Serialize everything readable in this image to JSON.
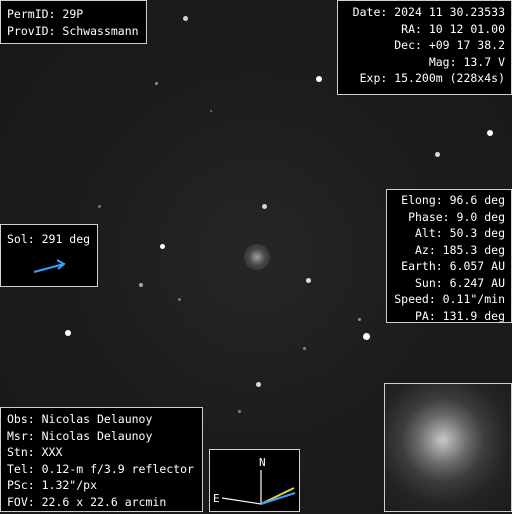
{
  "ident": {
    "perm_id_label": "PermID:",
    "perm_id": "29P",
    "prov_id_label": "ProvID:",
    "prov_id": "Schwassmann"
  },
  "observation_info": {
    "date": "Date: 2024 11 30.23533",
    "ra": "RA: 10 12 01.00",
    "dec": "Dec: +09 17 38.2",
    "mag": "Mag: 13.7 V",
    "exp": "Exp: 15.200m (228x4s)"
  },
  "geometry": {
    "elong": "Elong: 96.6 deg",
    "phase": "Phase: 9.0 deg",
    "alt": "Alt: 50.3 deg",
    "az": "Az: 185.3 deg",
    "earth": "Earth: 6.057 AU",
    "sun": "Sun: 6.247 AU",
    "speed": "Speed: 0.11\"/min",
    "pa": "PA: 131.9 deg"
  },
  "sol": {
    "label": "Sol: 291 deg",
    "arrow_color": "#3aa0ff"
  },
  "observer": {
    "obs": "Obs: Nicolas Delaunoy",
    "msr": "Msr: Nicolas Delaunoy",
    "stn": "Stn: XXX",
    "tel": "Tel: 0.12-m f/3.9 reflector",
    "psc": "PSc: 1.32\"/px",
    "fov": "FOV: 22.6 x 22.6 arcmin"
  },
  "compass": {
    "north": "N",
    "east": "E",
    "motion_color": "#e8d23a",
    "sun_color": "#3aa0ff"
  },
  "colors": {
    "background": "#1b1b1b",
    "box_fill": "#000000",
    "box_border": "#cfcfcf",
    "text": "#ffffff"
  }
}
